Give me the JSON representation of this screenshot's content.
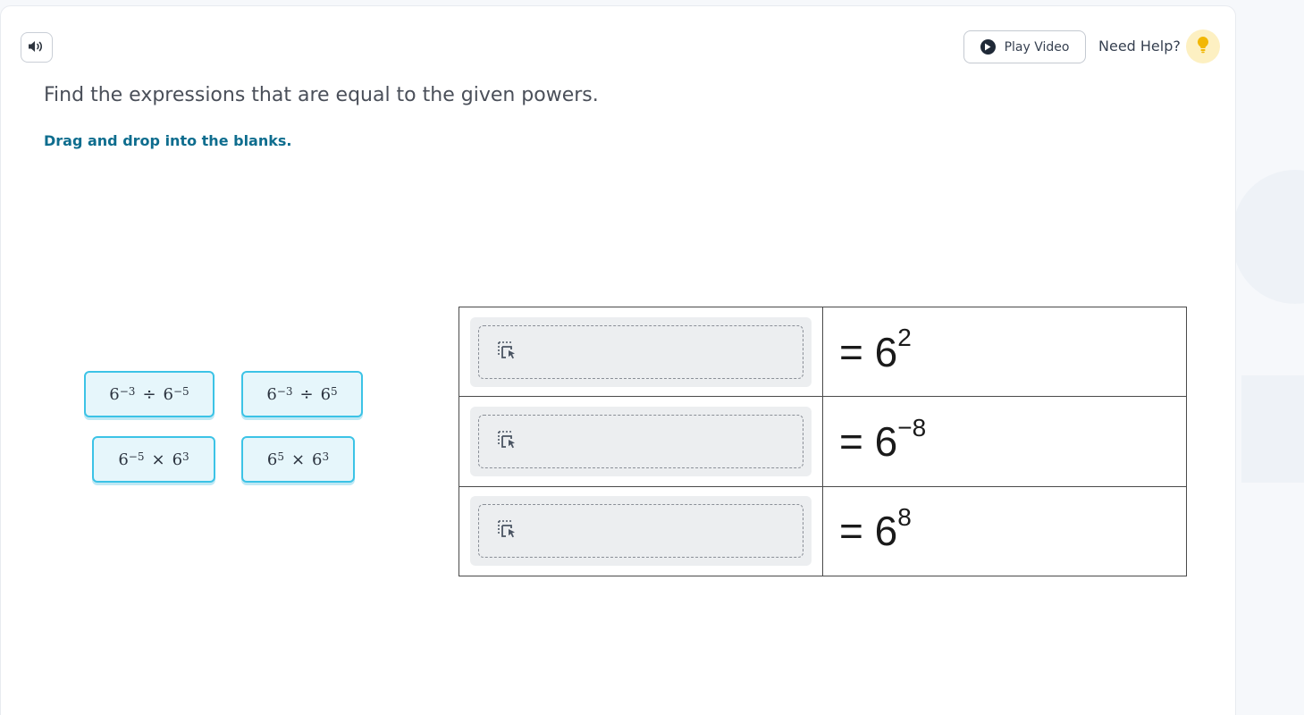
{
  "header": {
    "play_video_label": "Play Video",
    "need_help_label": "Need Help?"
  },
  "question": {
    "prompt": "Find the expressions that are equal to the given powers.",
    "instruction": "Drag and drop into the blanks."
  },
  "chips": [
    {
      "base1": "6",
      "exp1": "−3",
      "op": "÷",
      "base2": "6",
      "exp2": "−5"
    },
    {
      "base1": "6",
      "exp1": "−3",
      "op": "÷",
      "base2": "6",
      "exp2": "5"
    },
    {
      "base1": "6",
      "exp1": "−5",
      "op": "×",
      "base2": "6",
      "exp2": "3"
    },
    {
      "base1": "6",
      "exp1": "5",
      "op": "×",
      "base2": "6",
      "exp2": "3"
    }
  ],
  "rows": [
    {
      "prefix": "= ",
      "base": "6",
      "exponent": "2"
    },
    {
      "prefix": "= ",
      "base": "6",
      "exponent": "−8"
    },
    {
      "prefix": "= ",
      "base": "6",
      "exponent": "8"
    }
  ],
  "icons": {
    "speaker": "speaker-icon",
    "play": "play-icon",
    "bulb": "lightbulb-icon",
    "drop": "drag-drop-icon"
  },
  "colors": {
    "instruction": "#0e6d8e",
    "chip_border": "#3cc3e6",
    "chip_bg": "#e6f6fb",
    "bulb_bg": "#fdf0c2",
    "bulb": "#f2b705"
  }
}
